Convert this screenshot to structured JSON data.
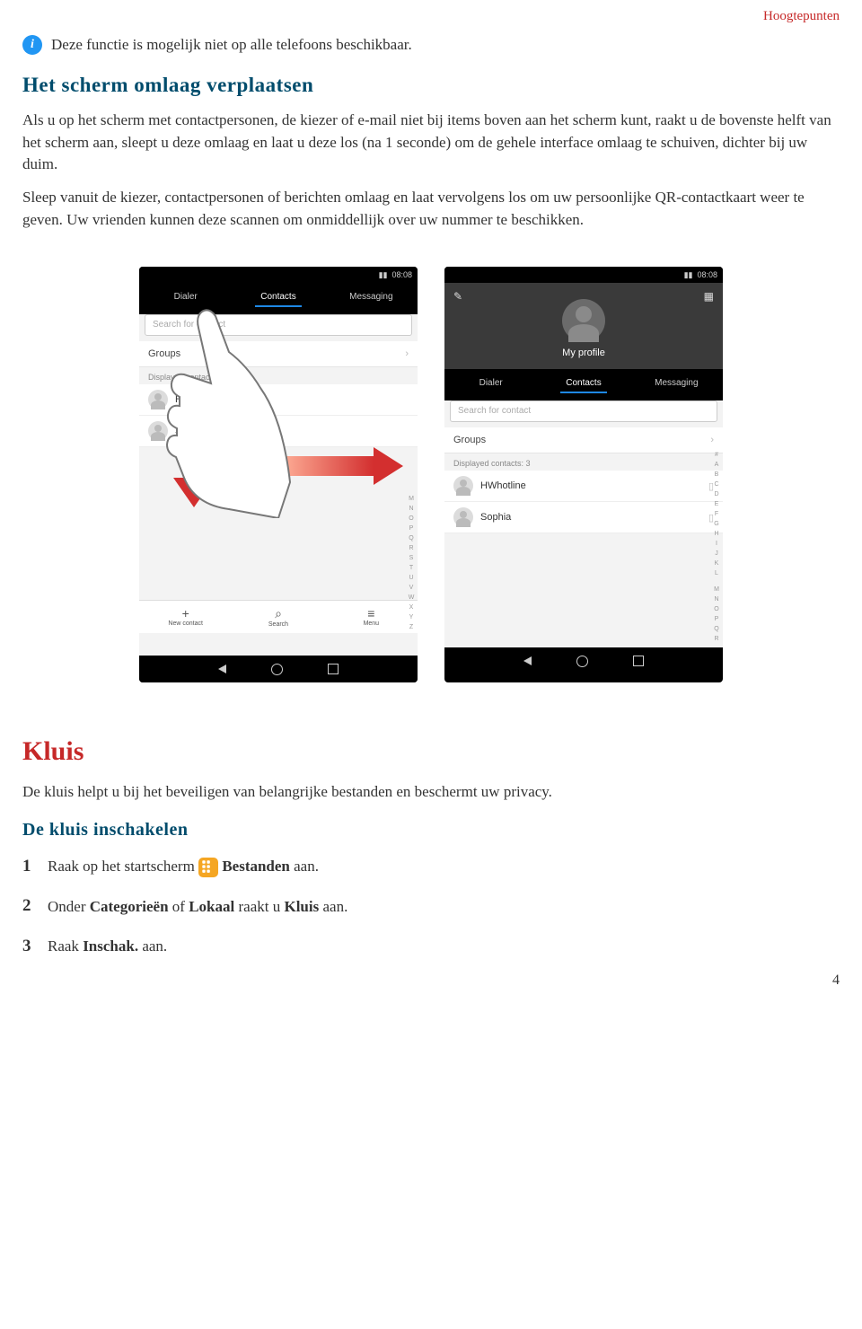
{
  "header": {
    "category": "Hoogtepunten"
  },
  "info_note": "Deze functie is mogelijk niet op alle telefoons beschikbaar.",
  "section1": {
    "title": "Het scherm omlaag verplaatsen",
    "p1": "Als u op het scherm met contactpersonen, de kiezer of e-mail niet bij items boven aan het scherm kunt, raakt u de bovenste helft van het scherm aan, sleept u deze omlaag en laat u deze los (na 1 seconde) om de gehele interface omlaag te schuiven, dichter bij uw duim.",
    "p2": "Sleep vanuit de kiezer, contactpersonen of berichten omlaag en laat vervolgens los om uw persoonlijke QR-contactkaart weer te geven. Uw vrienden kunnen deze scannen om onmiddellijk over uw nummer te beschikken."
  },
  "phone_common": {
    "time": "08:08",
    "tabs": [
      "Dialer",
      "Contacts",
      "Messaging"
    ],
    "search_placeholder": "Search for contact",
    "groups_label": "Groups",
    "section_label": "Displayed contacts: 3",
    "contact1": "HWhotline",
    "contact2": "Sophia",
    "index_letters_short": "#\nA\nB\nC\nD\nE\nF\nG\nH\nI\nJ\nK\nL",
    "index_letters_long": "M\nN\nO\nP\nQ\nR\nS\nT\nU\nV\nW\nX\nY\nZ",
    "my_profile": "My profile",
    "actions": {
      "new": "New contact",
      "search": "Search",
      "menu": "Menu"
    }
  },
  "section_kluis": {
    "title": "Kluis",
    "intro": "De kluis helpt u bij het beveiligen van belangrijke bestanden en beschermt uw privacy.",
    "subtitle": "De kluis inschakelen",
    "step1_a": "Raak op het startscherm",
    "step1_b": "Bestanden",
    "step1_c": " aan.",
    "step2_a": "Onder ",
    "step2_b": "Categorieën",
    "step2_c": " of ",
    "step2_d": "Lokaal",
    "step2_e": " raakt u ",
    "step2_f": "Kluis",
    "step2_g": " aan.",
    "step3_a": "Raak ",
    "step3_b": "Inschak.",
    "step3_c": " aan."
  },
  "page_number": "4"
}
